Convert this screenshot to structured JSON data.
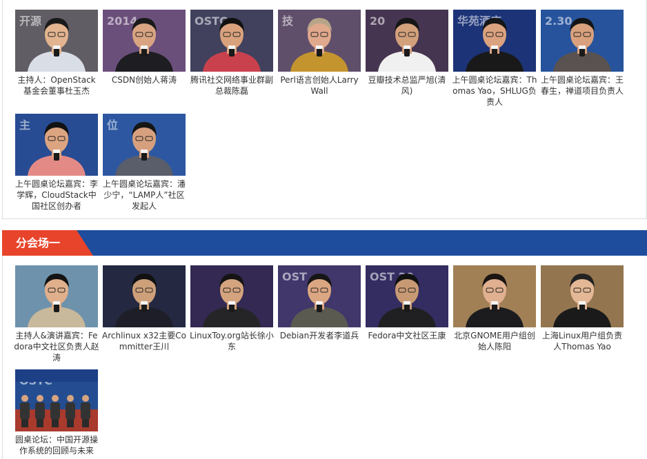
{
  "top_gallery": {
    "items": [
      {
        "caption": "主持人：OpenStack基金会董事杜玉杰",
        "bg": "#6f6a72",
        "shirt": "#d9dde6",
        "skin": "#e2b48f",
        "hair": "#1a1a1a",
        "stage_text": "开源"
      },
      {
        "caption": "CSDN创始人蒋涛",
        "bg": "#7a5a8c",
        "shirt": "#1d1d22",
        "skin": "#d8a482",
        "hair": "#1a1a1a",
        "stage_text": "2014"
      },
      {
        "caption": "腾讯社交网络事业群副总裁陈磊",
        "bg": "#4a4a6a",
        "shirt": "#c9414d",
        "skin": "#d9a27c",
        "hair": "#111111",
        "stage_text": "OSTC"
      },
      {
        "caption": "Perl语言创始人Larry Wall",
        "bg": "#6d5b7a",
        "shirt": "#c4942f",
        "skin": "#e0a88c",
        "hair": "#b7a58a",
        "stage_text": "技"
      },
      {
        "caption": "豆瓣技术总监严旭(清风)",
        "bg": "#503d5c",
        "shirt": "#f0f0f0",
        "skin": "#d3a07c",
        "hair": "#151515",
        "stage_text": "20"
      },
      {
        "caption": "上午圆桌论坛嘉宾：Thomas Yao，SHLUG负责人",
        "bg": "#203c88",
        "shirt": "#191919",
        "skin": "#dba27f",
        "hair": "#161616",
        "stage_text": "华苑酒店"
      },
      {
        "caption": "上午圆桌论坛嘉宾：王春生，禅道项目负责人",
        "bg": "#2c5fb2",
        "shirt": "#5a5250",
        "skin": "#d8a07c",
        "hair": "#141414",
        "stage_text": "2.30"
      },
      {
        "caption": "上午圆桌论坛嘉宾：李学辉，CloudStack中国社区创办者",
        "bg": "#2d57a8",
        "shirt": "#e48a86",
        "skin": "#dca480",
        "hair": "#121212",
        "stage_text": "主"
      },
      {
        "caption": "上午圆桌论坛嘉宾：潘少宁，“LAMP人”社区发起人",
        "bg": "#3465b8",
        "shirt": "#5a5d6a",
        "skin": "#d6a07e",
        "hair": "#151515",
        "stage_text": "位"
      }
    ]
  },
  "section": {
    "title": "分会场一",
    "tab_color": "#e8442b",
    "bar_color": "#1e4d9e"
  },
  "bottom_gallery": {
    "items": [
      {
        "caption": "主持人&演讲嘉宾：Fedora中文社区负责人赵涛",
        "bg": "#7ea7c3",
        "shirt": "#c8b89c",
        "skin": "#e0b08c",
        "hair": "#141414",
        "stage_text": ""
      },
      {
        "caption": "Archlinux x32主要Committer王川",
        "bg": "#2a2f4a",
        "shirt": "#1e1e28",
        "skin": "#cda07a",
        "hair": "#111111",
        "stage_text": ""
      },
      {
        "caption": "LinuxToy.org站长徐小东",
        "bg": "#3b2f5e",
        "shirt": "#252528",
        "skin": "#d4a47f",
        "hair": "#141414",
        "stage_text": ""
      },
      {
        "caption": "Debian开发者李道兵",
        "bg": "#4a3f7a",
        "shirt": "#5b5a50",
        "skin": "#dba682",
        "hair": "#161616",
        "stage_text": "OST"
      },
      {
        "caption": "Fedora中文社区王康",
        "bg": "#3c3470",
        "shirt": "#202022",
        "skin": "#c89a74",
        "hair": "#111111",
        "stage_text": "OST 20"
      },
      {
        "caption": "北京GNOME用户组创始人陈阳",
        "bg": "#b89262",
        "shirt": "#1c1c1e",
        "skin": "#e0b090",
        "hair": "#1a1412",
        "stage_text": ""
      },
      {
        "caption": "上海Linux用户组负责人Thomas Yao",
        "bg": "#a8865a",
        "shirt": "#1a1a1a",
        "skin": "#e4b896",
        "hair": "#222222",
        "stage_text": ""
      },
      {
        "caption": "圆桌论坛：中国开源操作系统的回顾与未来",
        "bg": "#2a58a6",
        "shirt": "#333333",
        "skin": "#d8a480",
        "hair": "#111111",
        "stage_text": "OSTC"
      }
    ]
  }
}
